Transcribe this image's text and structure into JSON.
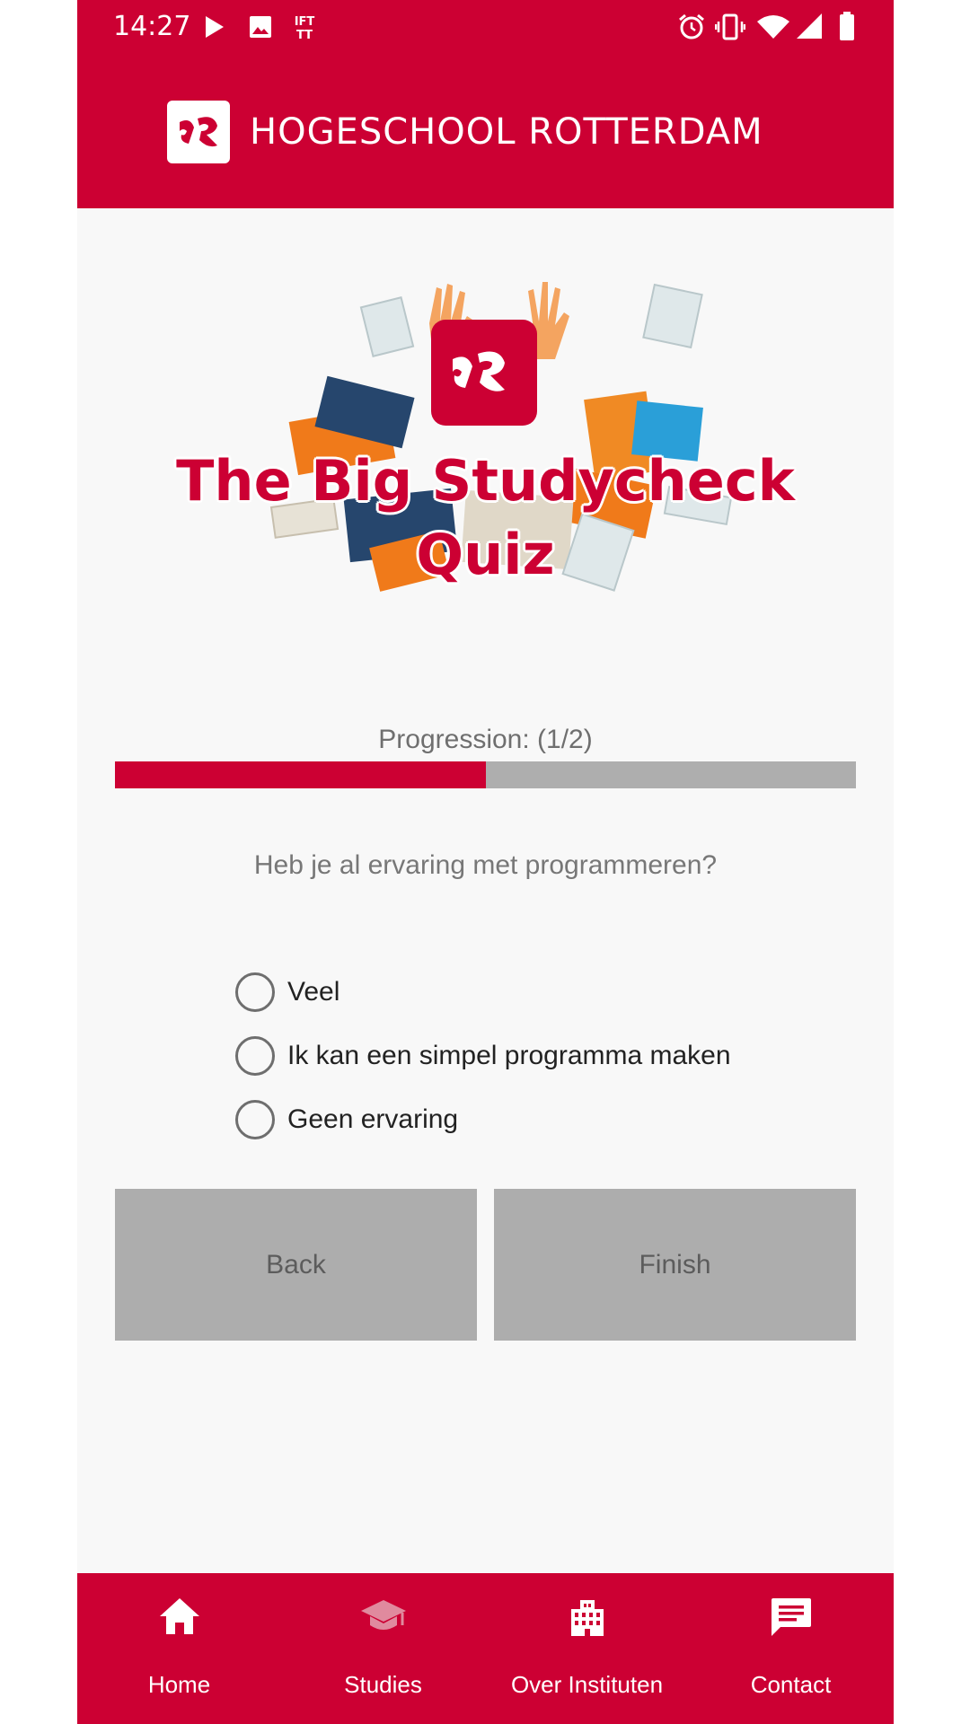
{
  "status_bar": {
    "time": "14:27",
    "left_icons": [
      "play-icon",
      "image-icon",
      "ifttt-icon"
    ],
    "right_icons": [
      "alarm-icon",
      "vibrate-icon",
      "wifi-icon",
      "signal-icon",
      "battery-icon"
    ]
  },
  "header": {
    "brand_name": "HOGESCHOOL ROTTERDAM",
    "logo_icon": "hr-logo-icon"
  },
  "hero": {
    "title_line1": "The Big Studycheck",
    "title_line2": "Quiz"
  },
  "progress": {
    "label": "Progression: (1/2)",
    "current": 1,
    "total": 2
  },
  "question": {
    "text": "Heb je al ervaring met programmeren?",
    "options": [
      {
        "label": "Veel",
        "selected": false
      },
      {
        "label": "Ik kan een simpel programma maken",
        "selected": false
      },
      {
        "label": "Geen ervaring",
        "selected": false
      }
    ]
  },
  "buttons": {
    "back_label": "Back",
    "finish_label": "Finish"
  },
  "bottom_nav": {
    "items": [
      {
        "label": "Home",
        "icon": "home-icon",
        "active": true
      },
      {
        "label": "Studies",
        "icon": "graduation-cap-icon",
        "active": false
      },
      {
        "label": "Over Instituten",
        "icon": "building-icon",
        "active": false
      },
      {
        "label": "Contact",
        "icon": "chat-icon",
        "active": false
      }
    ]
  },
  "colors": {
    "brand": "#cc0033",
    "background": "#f8f8f8",
    "button_gray": "#adadad",
    "track_gray": "#aeaeae"
  }
}
